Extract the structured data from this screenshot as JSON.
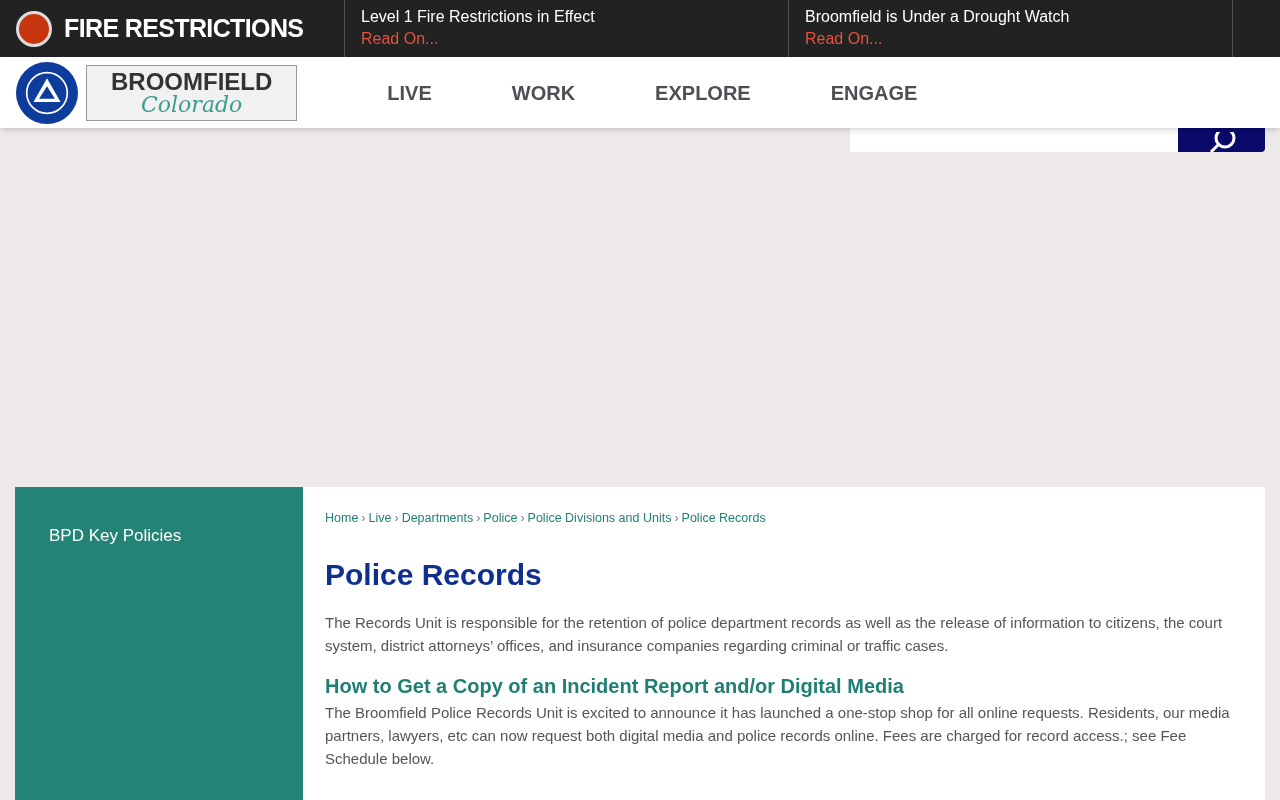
{
  "alert_bar": {
    "title": "FIRE RESTRICTIONS",
    "alerts": [
      {
        "headline": "Level 1 Fire Restrictions in Effect",
        "link": "Read On..."
      },
      {
        "headline": "Broomfield is Under a Drought Watch",
        "link": "Read On..."
      }
    ]
  },
  "logo": {
    "wordmark": "BROOMFIELD",
    "script": "Colorado"
  },
  "nav": [
    "LIVE",
    "WORK",
    "EXPLORE",
    "ENGAGE"
  ],
  "sidebar": {
    "items": [
      "BPD Key Policies"
    ]
  },
  "breadcrumb_separator": "›",
  "breadcrumbs": [
    "Home",
    "Live",
    "Departments",
    "Police",
    "Police Divisions and Units",
    "Police Records"
  ],
  "page_title": "Police Records",
  "intro": "The Records Unit is responsible for the retention of police department records as well as the release of information to citizens, the court system, district attorneys’ offices, and insurance companies regarding criminal or traffic cases.",
  "sections": [
    {
      "heading": "How to Get a Copy of an Incident Report and/or Digital Media",
      "body": "The Broomfield Police Records Unit is excited to announce it has launched a one-stop shop for all online requests. Residents, our media partners, lawyers, etc can now request both digital media and police records online. Fees are charged for record access.; see Fee Schedule below."
    }
  ]
}
